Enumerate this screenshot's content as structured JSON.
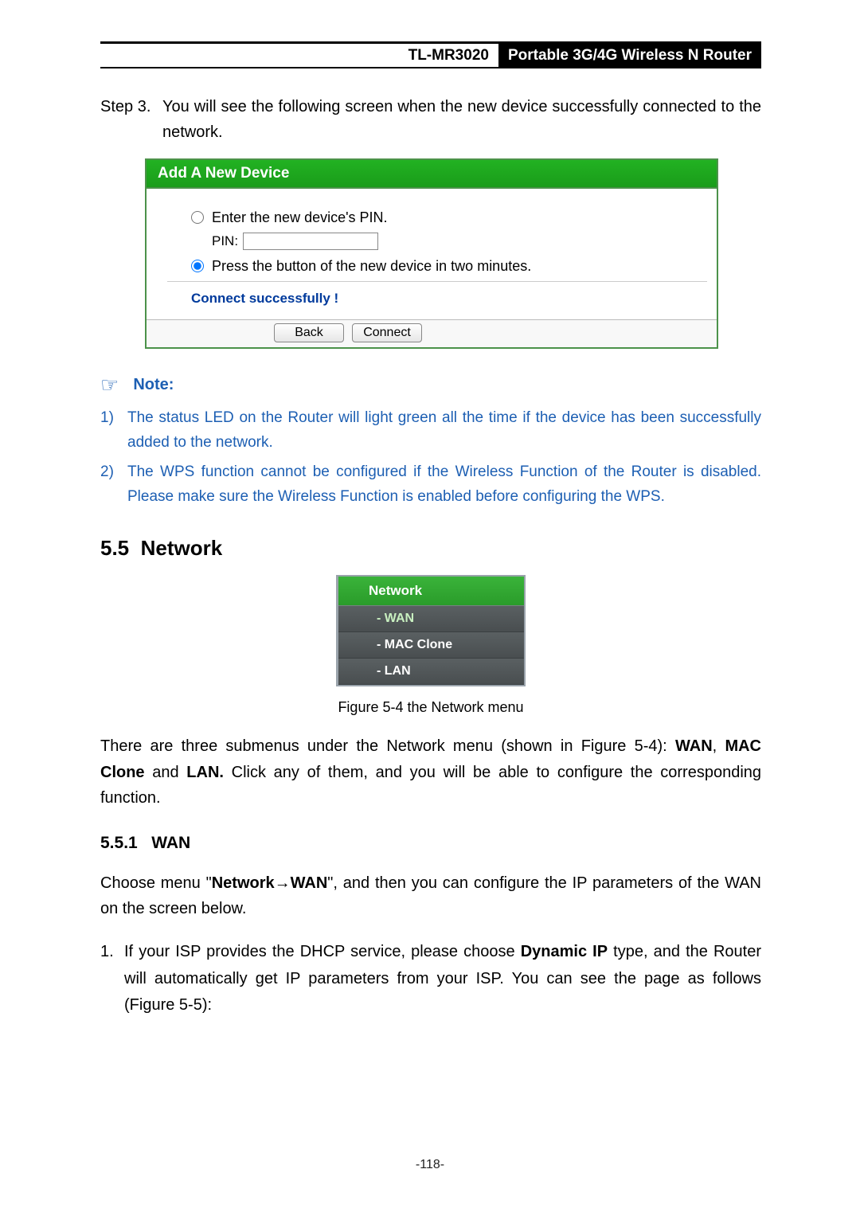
{
  "header": {
    "model": "TL-MR3020",
    "product": "Portable 3G/4G Wireless N Router"
  },
  "step": {
    "label": "Step 3.",
    "text": "You will see the following screen when the new device successfully connected to the network."
  },
  "panel": {
    "title": "Add A New Device",
    "opt_pin": "Enter the new device's PIN.",
    "pin_label": "PIN:",
    "pin_value": "",
    "opt_btn": "Press the button of the new device in two minutes.",
    "status": "Connect successfully !",
    "buttons": {
      "back": "Back",
      "connect": "Connect"
    }
  },
  "note": {
    "label": "Note:",
    "items": {
      "n1": {
        "num": "1)",
        "text": "The status LED on the Router will light green all the time if the device has been successfully added to the network."
      },
      "n2": {
        "num": "2)",
        "text": "The WPS function cannot be configured if the Wireless Function of the Router is disabled. Please make sure the Wireless Function is enabled before configuring the WPS."
      }
    }
  },
  "section": {
    "num": "5.5",
    "title": "Network"
  },
  "menu": {
    "head": "Network",
    "items": {
      "wan": "- WAN",
      "mac": "- MAC Clone",
      "lan": "- LAN"
    }
  },
  "caption": "Figure 5-4    the Network menu",
  "para1": {
    "pre": "There are three submenus under the Network menu (shown in Figure 5-4): ",
    "b1": "WAN",
    "c1": ", ",
    "b2": "MAC Clone",
    "mid": " and ",
    "b3": "LAN.",
    "post": " Click any of them, and you will be able to configure the corresponding function."
  },
  "subsection": {
    "num": "5.5.1",
    "title": "WAN"
  },
  "para2": {
    "pre": "Choose menu \"",
    "b1": "Network",
    "arrow": "→",
    "b2": "WAN",
    "post": "\", and then you can configure the IP parameters of the WAN on the screen below."
  },
  "list1": {
    "num": "1.",
    "pre": "If your ISP provides the DHCP service, please choose ",
    "b1": "Dynamic IP",
    "post": " type, and the Router will automatically get IP parameters from your ISP. You can see the page as follows (Figure 5-5):"
  },
  "page_number": "-118-"
}
